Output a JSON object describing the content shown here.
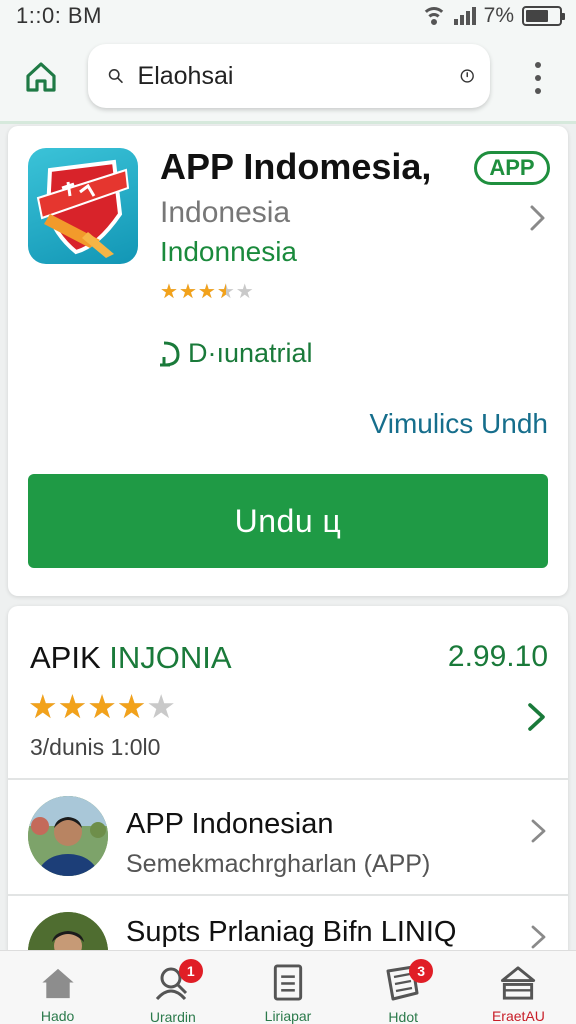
{
  "status_bar": {
    "time": "1::0: BM",
    "battery_text": "7%",
    "battery_level": 0.7
  },
  "search": {
    "query": "Elaohsai"
  },
  "app": {
    "title": "APP Indomesia,",
    "badge": "APP",
    "region": "Indonesia",
    "publisher": "Indonnesia",
    "rating": 3.5,
    "feature_label": "D·ıunatrial",
    "more_link": "Vimulics Undh",
    "install_label": "Undu ц"
  },
  "detail": {
    "title_part1": "APIK",
    "title_part2": "INJONIA",
    "version": "2.99.10",
    "rating": 4,
    "review_count": "3/dunis 1:0l0"
  },
  "list": [
    {
      "title": "APP Indonesian",
      "subtitle": "Semekmachrgharlan (APP)"
    },
    {
      "title": "Supts Prlaniag Bifn LINIQ",
      "subtitle": ""
    }
  ],
  "bottom_nav": [
    {
      "label": "Hado",
      "icon": "home-icon",
      "badge": ""
    },
    {
      "label": "Urardin",
      "icon": "person-search-icon",
      "badge": "1"
    },
    {
      "label": "Liriapar",
      "icon": "document-icon",
      "badge": ""
    },
    {
      "label": "Hdot",
      "icon": "notes-icon",
      "badge": "3"
    },
    {
      "label": "EraetAU",
      "icon": "store-icon",
      "badge": ""
    }
  ],
  "colors": {
    "accent_green": "#1f9a45",
    "link_blue": "#166e8c",
    "star_gold": "#f2a21b",
    "badge_red": "#e01e26"
  }
}
